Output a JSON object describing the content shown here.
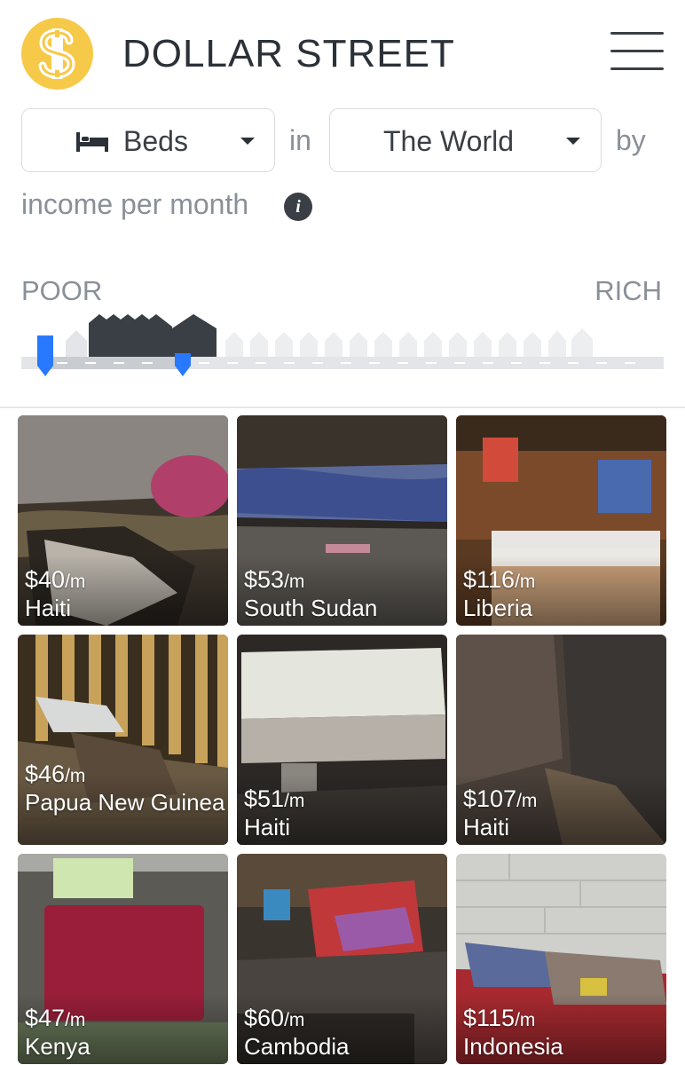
{
  "header": {
    "brand": "DOLLAR STREET",
    "logo_icon": "dollar-coin-icon",
    "menu_icon": "hamburger-menu-icon",
    "logo_color": "#f7c948"
  },
  "filters": {
    "topic_icon": "bed-icon",
    "topic": "Beds",
    "in_text": "in",
    "region": "The World",
    "by_text": "by",
    "measure_text": "income per month",
    "info_icon": "info-icon"
  },
  "scale": {
    "poor_label": "POOR",
    "rich_label": "RICH",
    "accent": "#2979ff",
    "range_min_fraction": 0.0,
    "range_max_fraction": 0.25
  },
  "homes": [
    {
      "amount": "$40",
      "unit": "/m",
      "country": "Haiti"
    },
    {
      "amount": "$53",
      "unit": "/m",
      "country": "South Sudan"
    },
    {
      "amount": "$116",
      "unit": "/m",
      "country": "Liberia"
    },
    {
      "amount": "$46",
      "unit": "/m",
      "country": "Papua New Guinea"
    },
    {
      "amount": "$51",
      "unit": "/m",
      "country": "Haiti"
    },
    {
      "amount": "$107",
      "unit": "/m",
      "country": "Haiti"
    },
    {
      "amount": "$47",
      "unit": "/m",
      "country": "Kenya"
    },
    {
      "amount": "$60",
      "unit": "/m",
      "country": "Cambodia"
    },
    {
      "amount": "$115",
      "unit": "/m",
      "country": "Indonesia"
    }
  ]
}
